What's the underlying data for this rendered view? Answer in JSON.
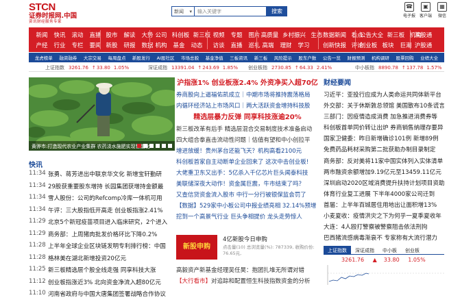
{
  "header": {
    "logo_mark": "STCN",
    "logo_name": "证券时报网.中国",
    "logo_slogan": "资讯财经服务专家",
    "search": {
      "select": "新闻",
      "placeholder": "输入关键字",
      "button": "搜索"
    },
    "icons": [
      {
        "name": "phone-icon",
        "label": "电子报",
        "glyph": "☎"
      },
      {
        "name": "app-icon",
        "label": "客户端",
        "glyph": "▣"
      },
      {
        "name": "qrcode-icon",
        "label": "微信",
        "glyph": "▦"
      }
    ]
  },
  "nav": {
    "groups": [
      {
        "rows": [
          [
            "新闻",
            "快讯",
            "滚动",
            "直播"
          ],
          [
            "产经",
            "行业",
            "专栏",
            "要闻"
          ]
        ]
      },
      {
        "rows": [
          [
            "股市",
            "解读",
            "大势"
          ],
          [
            "新股",
            "研报",
            "数据"
          ]
        ]
      },
      {
        "rows": [
          [
            "公司",
            "科创板",
            "新三板"
          ],
          [
            "机构",
            "基金",
            "动态"
          ]
        ]
      },
      {
        "rows": [
          [
            "视频",
            "专题",
            "图片"
          ],
          [
            "访谈",
            "直播",
            "巡礼"
          ]
        ]
      },
      {
        "rows": [
          [
            "高质量",
            "乡村振兴",
            "生态"
          ],
          [
            "高端",
            "理财",
            "学习"
          ]
        ]
      },
      {
        "rows": [
          [
            "数据新闻",
            "看点"
          ],
          [
            "创新快报",
            "评论"
          ]
        ]
      },
      {
        "rows": [
          [
            "公告大全",
            "新三板",
            "机构"
          ],
          [
            "创业板",
            "板块",
            "巨潮"
          ]
        ]
      },
      {
        "rows": [
          [
            "深股通"
          ],
          [
            "沪股通"
          ]
        ]
      }
    ],
    "blue": [
      "龙虎榜单",
      "融资融券",
      "大宗交易",
      "每周盘点",
      "新股发行",
      "AI股社区",
      "市场总貌",
      "基金净值",
      "三板资讯",
      "新三板",
      "风险提示",
      "股东户数",
      "公告一览",
      "财报预测",
      "机构调研",
      "股票回购",
      "业绩大全"
    ]
  },
  "ticker": [
    {
      "label": "上证指数",
      "value": "3261.76",
      "arrow": "↑",
      "change": "33.80",
      "pct": "1.05%"
    },
    {
      "label": "深证成指",
      "value": "13391.04",
      "arrow": "↑",
      "change": "243.69",
      "pct": "1.85%"
    },
    {
      "label": "创业板指",
      "value": "2730.85",
      "arrow": "↑",
      "change": "64.33",
      "pct": "2.41%"
    },
    {
      "label": "中小板指",
      "value": "8890.78",
      "arrow": "↑",
      "change": "137.78",
      "pct": "1.57%"
    }
  ],
  "photo": {
    "caption": "黄骅市:打造现代农业产业集群 农药浇水施肥实现智能化",
    "dots": 6,
    "active_dot": 0
  },
  "kuaixun": {
    "title": "快讯",
    "items": [
      {
        "time": "11:34",
        "text": "张勇、蒋芳进出中联京华文化 新增宝轩勤研"
      },
      {
        "time": "11:34",
        "text": "29股获重要股东增持 长园集团获增持金额最"
      },
      {
        "time": "11:34",
        "text": "雪人股份：公司的Refcomp冷库一体机可用"
      },
      {
        "time": "11:34",
        "text": "午评：三大股指低开高走 创业板指涨2.41%"
      },
      {
        "time": "11:29",
        "text": "北京5个新冠疫苗项目进入临床研究，2个进入"
      },
      {
        "time": "11:29",
        "text": "商务部：上周猪肉批发价格环比下降0.2%"
      },
      {
        "time": "11:28",
        "text": "上半年全球企业区块链发明专利排行榜：中国"
      },
      {
        "time": "11:28",
        "text": "格林美在湖北新增投资20亿元"
      },
      {
        "time": "11:25",
        "text": "新三板精选层个股全线走强 同享科技大涨"
      },
      {
        "time": "11:12",
        "text": "创业板指涨近3% 北向资金净流入超80亿元"
      },
      {
        "time": "11:10",
        "text": "河南省政府与中国大唐集团签署战略合作协议"
      }
    ]
  },
  "middle": {
    "headline1": "沪指涨1% 创业板涨2.4% 外资净买入超70亿",
    "lines1": [
      {
        "text": "券商股向上逼福佑凯成立｜中期市场将推持震荡格局",
        "dark": false
      },
      {
        "text": "内循环经济站上市场风口｜两大活跃资金增持科技股",
        "dark": false
      }
    ],
    "headline2": "精选层暴力反弹 同享科技涨逾20%",
    "lines2": [
      {
        "text": "新三板改革有后手 精选层混合交易制度技术准备启动",
        "dark": true
      },
      {
        "text": "四大组合拳直击流动性问题｜估值有望和中小创拉平",
        "dark": true
      },
      {
        "text": "增进放缓！贵州茅台还能飞天？机构高看2100元",
        "dark": false
      },
      {
        "text": "科创板首家自主动断单企业回来了 这次中击创业板!",
        "dark": false
      },
      {
        "text": "大佬重卫东又出手：5亿杀入千亿芯片巨头闻泰科技",
        "dark": false
      },
      {
        "text": "美联储深夜大动作！资金属巨震，牛市结束了吗？",
        "dark": false
      },
      {
        "text": "又查信贷资金流入股市 中行一分行被银保监会罚了",
        "dark": false
      },
      {
        "text": "【数据】529家中小板公司中报业绩亮相 32.14%预增",
        "dark": false
      },
      {
        "text": "挖到一个高景气行业 巨头争相提价 龙头走势惊人",
        "dark": false
      }
    ]
  },
  "ad": {
    "image_text": "新股申购",
    "title": "4亿新股今日申购",
    "meta1": "点击量(10) 总浏览量(%): 787339, 收购价份:",
    "meta2": "76.65元,"
  },
  "ad_lines": [
    {
      "tag": "",
      "text": "高毅资产新基金经理吴任昊：抱团扎堆无所谓对错"
    },
    {
      "tag": "【大行看市】",
      "text": "对追踪和配置恒生科技指数资金的分析"
    }
  ],
  "right": {
    "title": "财经要闻",
    "lines": [
      "习近平：亚投行应成为人类命运共同体新平台",
      "外交部：关于休斯敦总领馆 美国散布10条谎言",
      "三部门：因疫情造成消费 加急推进消费券等",
      "科创板首单同价转让出炉 券商销售纳理存要异",
      "国家卫健委：昨日新增确诊101例 新增89例",
      "免费药品耗材采购第二批获助办制目录制定",
      "商务部：反对美将11家中国实体列入实体清单",
      "两市融资余额增加9.19亿元至13459.11亿元",
      "深圳启动2020区域消费提升扶持计划项目资助",
      "体育行业复工进展 下半年4000家公司迁到",
      "首届：上半年百城居住用地出让面积增13%",
      "小麦夏收：疫情洪灾之下为何乎一夏季夏收年",
      "大连：4人殴打警察被警察阻击依法刑拘",
      "巴西猪流感病毒渐衰不 专家称有大流行潜力"
    ]
  },
  "market_tabs": {
    "tabs": [
      "上证指数",
      "深证成指",
      "中小板",
      "创业板"
    ],
    "active": 0
  },
  "quote": {
    "value": "3261.76",
    "arrow": "▲",
    "change": "33.80",
    "pct": "1.05%"
  }
}
